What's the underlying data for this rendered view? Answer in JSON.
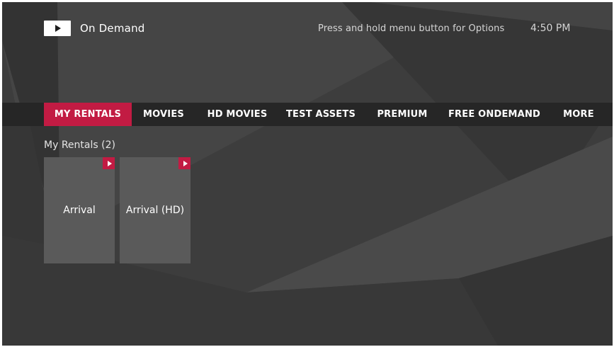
{
  "header": {
    "logo_icon": "play-icon",
    "title": "On Demand",
    "hint": "Press and hold menu button for Options",
    "time": "4:50 PM"
  },
  "nav": {
    "tabs": [
      {
        "label": "MY RENTALS",
        "active": true
      },
      {
        "label": "MOVIES",
        "active": false
      },
      {
        "label": "HD MOVIES",
        "active": false
      },
      {
        "label": "TEST ASSETS",
        "active": false
      },
      {
        "label": "PREMIUM",
        "active": false
      },
      {
        "label": "FREE ONDEMAND",
        "active": false
      },
      {
        "label": "MORE",
        "active": false
      }
    ]
  },
  "section": {
    "title": "My Rentals (2)"
  },
  "rentals": [
    {
      "title": "Arrival",
      "badge_icon": "play-icon"
    },
    {
      "title": "Arrival (HD)",
      "badge_icon": "play-icon"
    }
  ],
  "colors": {
    "accent": "#c21b43",
    "background": "#3d3d3d",
    "nav_bar": "#262626",
    "tile": "#5a5a5a"
  }
}
